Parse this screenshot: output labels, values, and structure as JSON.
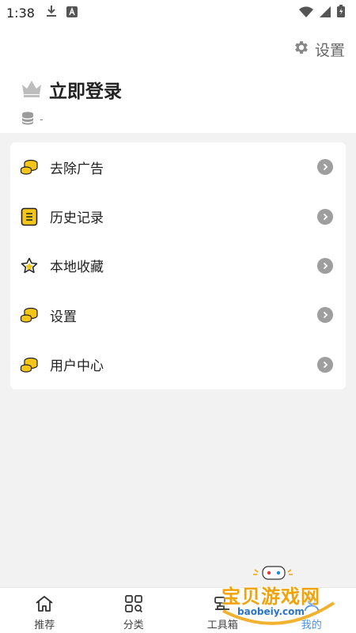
{
  "status_bar": {
    "time": "1:38",
    "icons": [
      "download-icon",
      "a-badge-icon",
      "wifi-icon",
      "signal-icon",
      "battery-icon"
    ]
  },
  "header": {
    "settings_label": "设置",
    "login_label": "立即登录",
    "coin_value": "-"
  },
  "menu": {
    "items": [
      {
        "label": "去除广告",
        "icon": "coins-icon"
      },
      {
        "label": "历史记录",
        "icon": "history-list-icon"
      },
      {
        "label": "本地收藏",
        "icon": "star-icon"
      },
      {
        "label": "设置",
        "icon": "coins-icon"
      },
      {
        "label": "用户中心",
        "icon": "coins-icon"
      }
    ]
  },
  "bottom_nav": {
    "tabs": [
      {
        "label": "推荐",
        "icon": "home-icon",
        "active": false
      },
      {
        "label": "分类",
        "icon": "category-icon",
        "active": false
      },
      {
        "label": "工具箱",
        "icon": "toolbox-icon",
        "active": false
      },
      {
        "label": "我的",
        "icon": "profile-icon",
        "active": true
      }
    ]
  },
  "watermark": {
    "title": "宝贝游戏网",
    "subtitle": "baobeiy.com"
  },
  "colors": {
    "accent": "#4a90e2",
    "coin_gold": "#f5c518",
    "arrow_gray": "#9e9e9e"
  }
}
